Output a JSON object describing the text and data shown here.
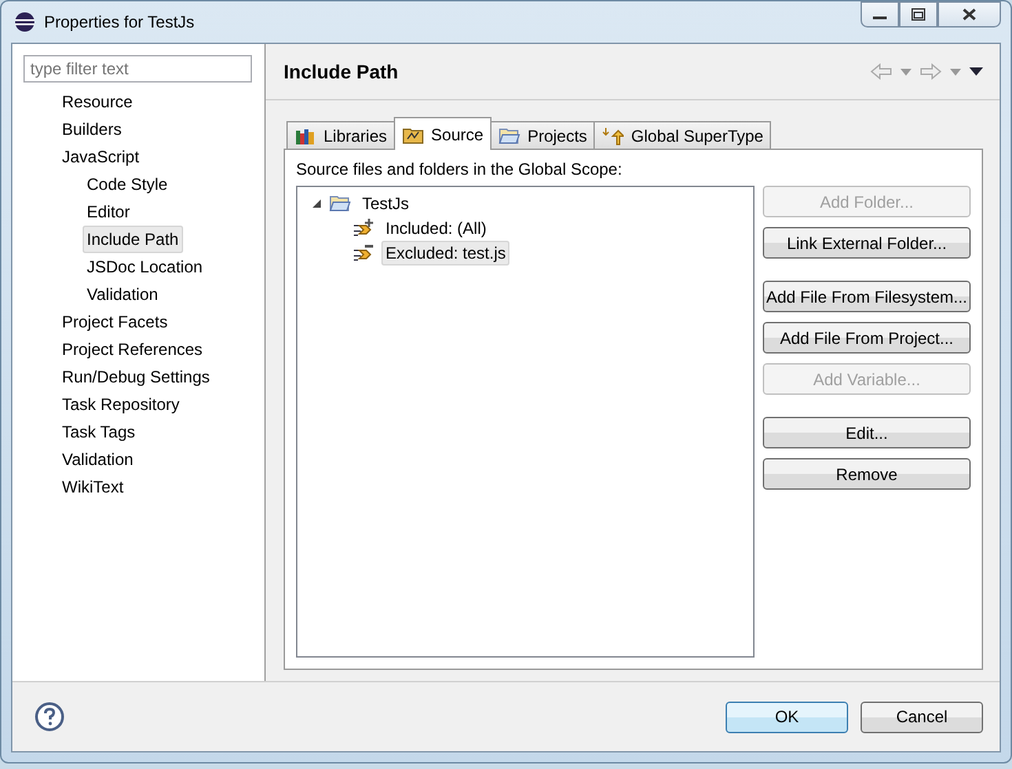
{
  "window": {
    "title": "Properties for TestJs"
  },
  "filter": {
    "placeholder": "type filter text"
  },
  "nav": [
    {
      "label": "Resource",
      "selected": false
    },
    {
      "label": "Builders",
      "selected": false
    },
    {
      "label": "JavaScript",
      "selected": false,
      "children": [
        {
          "label": "Code Style",
          "selected": false
        },
        {
          "label": "Editor",
          "selected": false
        },
        {
          "label": "Include Path",
          "selected": true
        },
        {
          "label": "JSDoc Location",
          "selected": false
        },
        {
          "label": "Validation",
          "selected": false
        }
      ]
    },
    {
      "label": "Project Facets",
      "selected": false
    },
    {
      "label": "Project References",
      "selected": false
    },
    {
      "label": "Run/Debug Settings",
      "selected": false
    },
    {
      "label": "Task Repository",
      "selected": false
    },
    {
      "label": "Task Tags",
      "selected": false
    },
    {
      "label": "Validation",
      "selected": false
    },
    {
      "label": "WikiText",
      "selected": false
    }
  ],
  "page": {
    "title": "Include Path"
  },
  "tabs": [
    {
      "label": "Libraries",
      "kind": "libraries",
      "selected": false
    },
    {
      "label": "Source",
      "kind": "source",
      "selected": true
    },
    {
      "label": "Projects",
      "kind": "projects",
      "selected": false
    },
    {
      "label": "Global SuperType",
      "kind": "supertype",
      "selected": false
    }
  ],
  "source": {
    "label": "Source files and folders in the Global Scope:",
    "tree": [
      {
        "label": "TestJs",
        "expanded": true,
        "selected": false,
        "children": [
          {
            "label": "Included: (All)",
            "kind": "included",
            "selected": false
          },
          {
            "label": "Excluded: test.js",
            "kind": "excluded",
            "selected": true
          }
        ]
      }
    ],
    "button_groups": [
      [
        {
          "label": "Add Folder...",
          "disabled": true
        },
        {
          "label": "Link External Folder...",
          "disabled": false
        }
      ],
      [
        {
          "label": "Add File From Filesystem...",
          "disabled": false
        },
        {
          "label": "Add File From Project...",
          "disabled": false
        },
        {
          "label": "Add Variable...",
          "disabled": true
        }
      ],
      [
        {
          "label": "Edit...",
          "disabled": false
        },
        {
          "label": "Remove",
          "disabled": false
        }
      ]
    ]
  },
  "footer": {
    "buttons": [
      {
        "label": "OK",
        "default": true
      },
      {
        "label": "Cancel",
        "default": false
      }
    ]
  }
}
